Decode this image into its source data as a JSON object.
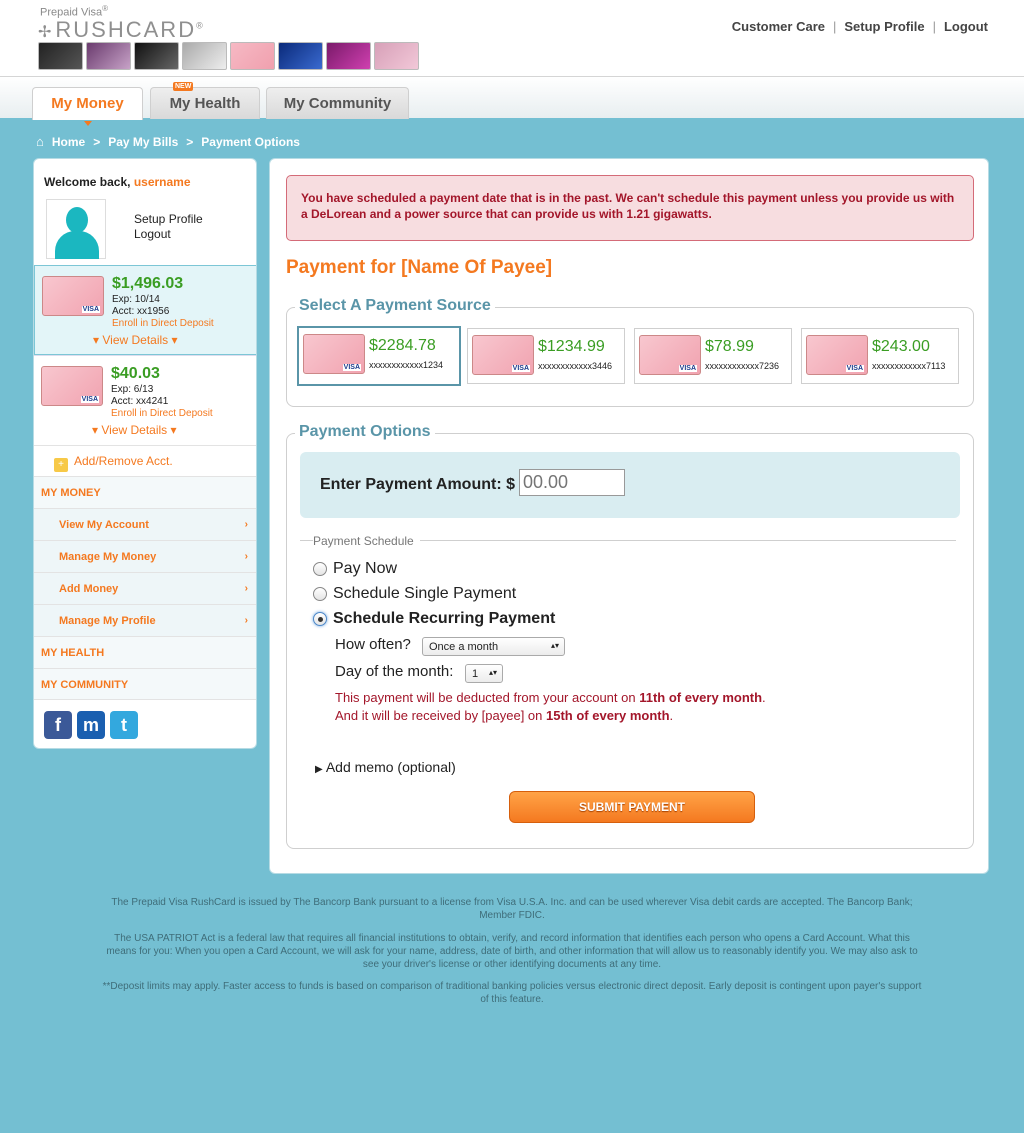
{
  "header": {
    "prepaid_label": "Prepaid Visa",
    "reg_mark": "®",
    "logo_text": "RUSHCARD",
    "logo_tm": "®",
    "links": [
      "Customer Care",
      "Setup Profile",
      "Logout"
    ],
    "link_separator": "|"
  },
  "tabs": [
    {
      "label": "My Money",
      "active": true
    },
    {
      "label": "My Health",
      "badge": "NEW"
    },
    {
      "label": "My Community"
    }
  ],
  "breadcrumb": [
    "Home",
    "Pay My Bills",
    "Payment Options"
  ],
  "breadcrumb_separator": ">",
  "sidebar": {
    "welcome_prefix": "Welcome back,",
    "username": "username",
    "setup_profile": "Setup Profile",
    "logout": "Logout",
    "accounts": [
      {
        "balance": "$1,496.03",
        "exp": "Exp: 10/14",
        "acct": "Acct: xx1956",
        "enroll": "Enroll in Direct Deposit",
        "details": "View Details"
      },
      {
        "balance": "$40.03",
        "exp": "Exp: 6/13",
        "acct": "Acct: xx4241",
        "enroll": "Enroll in Direct Deposit",
        "details": "View Details"
      }
    ],
    "add_remove": "Add/Remove Acct.",
    "sections": {
      "my_money": "MY MONEY",
      "my_health": "MY HEALTH",
      "my_community": "MY COMMUNITY"
    },
    "money_items": [
      "View My Account",
      "Manage My Money",
      "Add Money",
      "Manage My Profile"
    ],
    "social": [
      "f",
      "m",
      "t"
    ]
  },
  "main": {
    "alert": "You have scheduled a payment date that is in the past. We can't schedule this payment unless you provide us with a DeLorean and a power source that can provide us with 1.21 gigawatts.",
    "title": "Payment for [Name Of Payee]",
    "source_legend": "Select A Payment Source",
    "sources": [
      {
        "amount": "$2284.78",
        "number": "xxxxxxxxxxxx1234",
        "selected": true
      },
      {
        "amount": "$1234.99",
        "number": "xxxxxxxxxxxx3446"
      },
      {
        "amount": "$78.99",
        "number": "xxxxxxxxxxxx7236"
      },
      {
        "amount": "$243.00",
        "number": "xxxxxxxxxxxx7113"
      }
    ],
    "options_legend": "Payment Options",
    "amount_label": "Enter Payment Amount: $",
    "amount_placeholder": "00.00",
    "schedule_label": "Payment Schedule",
    "radios": [
      {
        "label": "Pay Now",
        "checked": false
      },
      {
        "label": "Schedule Single Payment",
        "checked": false
      },
      {
        "label": "Schedule Recurring Payment",
        "checked": true
      }
    ],
    "how_often_label": "How often?",
    "how_often_value": "Once a month",
    "day_label": "Day of the month:",
    "day_value": "1",
    "note1_pre": "This payment will be deducted from your account on ",
    "note1_bold": "11th of every month",
    "note1_post": ".",
    "note2_pre": "And it will be received by [payee] on ",
    "note2_bold": "15th of every month",
    "note2_post": ".",
    "memo": "Add memo (optional)",
    "submit": "SUBMIT PAYMENT"
  },
  "footer": [
    "The Prepaid Visa RushCard is issued by The Bancorp Bank pursuant to a license from Visa U.S.A. Inc. and can be used wherever Visa debit cards are accepted. The Bancorp Bank; Member FDIC.",
    "The USA PATRIOT Act is a federal law that requires all financial institutions to obtain, verify, and record information that identifies each person who opens a Card Account. What this means for you: When you open a Card Account, we will ask for your name, address, date of birth, and other information that will allow us to reasonably identify you. We may also ask to see your driver's license or other identifying documents at any time.",
    "**Deposit limits may apply. Faster access to funds is based on comparison of traditional banking policies versus electronic direct deposit. Early deposit is contingent upon payer's support of this feature."
  ],
  "colors": {
    "accent": "#f47920",
    "background": "#74bfd2",
    "money_green": "#3a9d23",
    "alert_red": "#a3162a"
  }
}
